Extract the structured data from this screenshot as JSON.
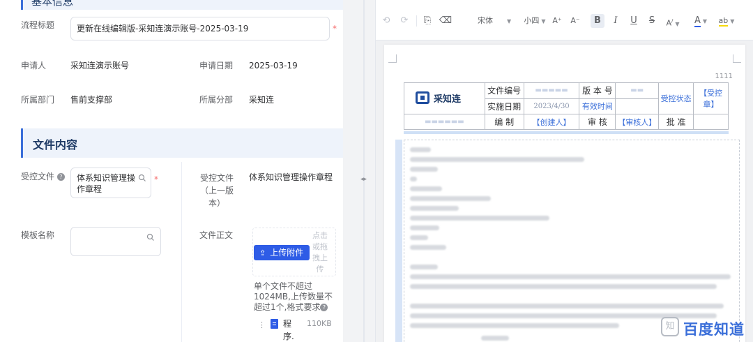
{
  "form": {
    "top_section_label": "基本信息",
    "process_title_label": "流程标题",
    "process_title_value": "更新在线编辑版-采知连演示账号-2025-03-19",
    "applicant_label": "申请人",
    "applicant_value": "采知连演示账号",
    "apply_date_label": "申请日期",
    "apply_date_value": "2025-03-19",
    "dept_label": "所属部门",
    "dept_value": "售前支撑部",
    "branch_label": "所属分部",
    "branch_value": "采知连",
    "required_mark": "*",
    "section_title": "文件内容",
    "controlled_file_label": "受控文件",
    "controlled_file_value": "体系知识管理操作章程",
    "prev_controlled_file_label": "受控文件（上一版本）",
    "prev_controlled_file_value": "体系知识管理操作章程",
    "template_label": "模板名称",
    "file_body_label": "文件正文",
    "upload_button_label": "上传附件",
    "drop_hint": "点击或拖拽上传",
    "upload_tip": "单个文件不超过1024MB,上传数量不超过1个,格式要求",
    "file_name": "程序.",
    "file_size": "110KB"
  },
  "editor": {
    "font_name": "宋体",
    "font_size": "小四",
    "page_number": "1111",
    "table": {
      "logo_text": "采知连",
      "doc_no_label": "文件编号",
      "version_label": "版 本 号",
      "controlled_status_label": "受控状态",
      "controlled_status_value": "【受控章】",
      "effective_date_label": "实施日期",
      "effective_date_value": "2023/4/30",
      "valid_time_label": "有效时间",
      "drafter_label": "编 制",
      "drafter_value": "【创建人】",
      "reviewer_label": "审 核",
      "reviewer_value": "【审核人】",
      "approver_label": "批 准"
    }
  },
  "watermark": {
    "text": "百度知道"
  }
}
